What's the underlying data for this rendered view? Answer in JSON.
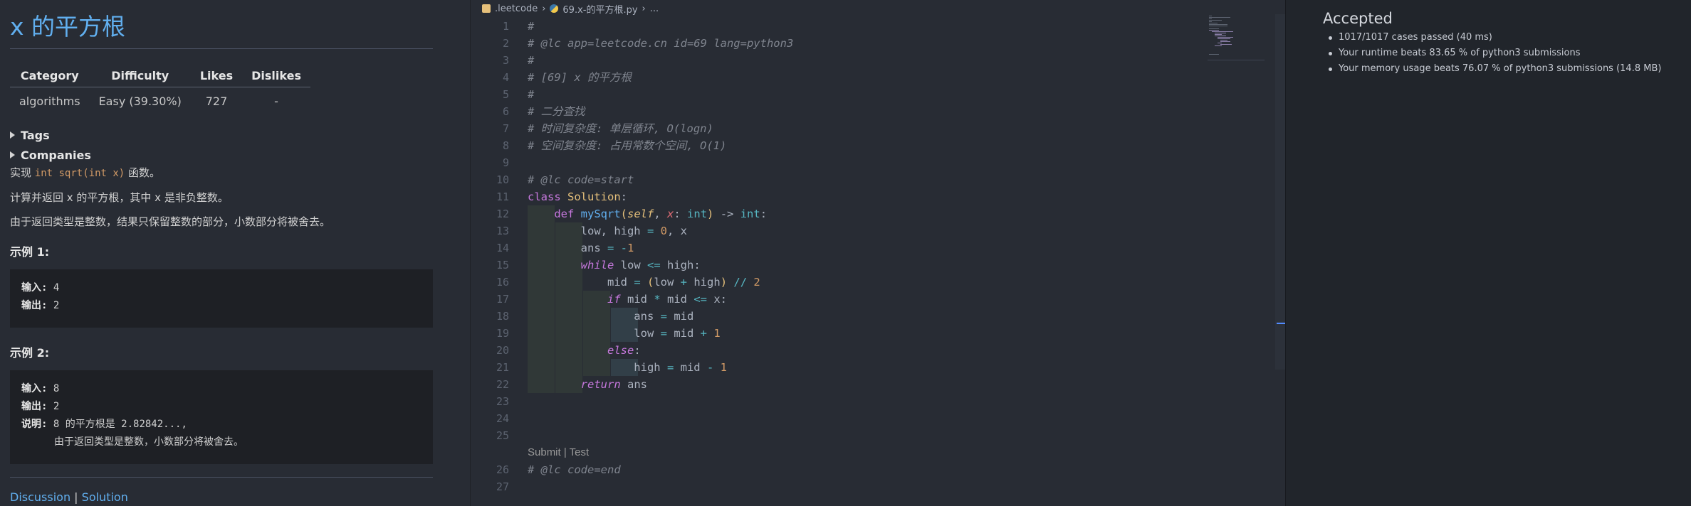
{
  "problem": {
    "title": "x 的平方根",
    "table": {
      "headers": [
        "Category",
        "Difficulty",
        "Likes",
        "Dislikes"
      ],
      "row": [
        "algorithms",
        "Easy (39.30%)",
        "727",
        "-"
      ]
    },
    "tags_label": "Tags",
    "companies_label": "Companies",
    "desc1_pre": "实现 ",
    "desc1_code": "int sqrt(int x)",
    "desc1_post": " 函数。",
    "desc2": "计算并返回 x 的平方根，其中 x 是非负整数。",
    "desc3": "由于返回类型是整数，结果只保留整数的部分，小数部分将被舍去。",
    "example1": {
      "heading": "示例 1:",
      "input_label": "输入:",
      "input_value": " 4",
      "output_label": "输出:",
      "output_value": " 2"
    },
    "example2": {
      "heading": "示例 2:",
      "input_label": "输入:",
      "input_value": " 8",
      "output_label": "输出:",
      "output_value": " 2",
      "explain_label": "说明:",
      "explain_value": " 8 的平方根是 2.82842...,",
      "explain_cont": "由于返回类型是整数，小数部分将被舍去。"
    },
    "link_discussion": "Discussion",
    "link_sep": " | ",
    "link_solution": "Solution"
  },
  "editor": {
    "breadcrumb": [
      ".leetcode",
      "69.x-的平方根.py",
      "..."
    ],
    "line_numbers": [
      "1",
      "2",
      "3",
      "4",
      "5",
      "6",
      "7",
      "8",
      "9",
      "10",
      "11",
      "12",
      "13",
      "14",
      "15",
      "16",
      "17",
      "18",
      "19",
      "20",
      "21",
      "22",
      "23",
      "24",
      "25",
      "26",
      "27"
    ],
    "lines": {
      "l1": "#",
      "l2": "# @lc app=leetcode.cn id=69 lang=python3",
      "l3": "#",
      "l4": "# [69] x 的平方根",
      "l5": "#",
      "l6": "# 二分查找",
      "l7": "# 时间复杂度: 单层循环, O(logn)",
      "l8": "# 空间复杂度: 占用常数个空间, O(1)",
      "l10": "# @lc code=start",
      "l26": "# @lc code=end"
    },
    "codelens": "Submit | Test"
  },
  "results": {
    "status": "Accepted",
    "items": [
      "1017/1017 cases passed (40 ms)",
      "Your runtime beats 83.65 % of python3 submissions",
      "Your memory usage beats 76.07 % of python3 submissions (14.8 MB)"
    ]
  },
  "colors": {
    "accent_blue": "#61afef",
    "comment": "#7f848e",
    "keyword": "#c678dd",
    "class": "#e5c07b",
    "number": "#d19a66",
    "operator": "#56b6c2"
  }
}
